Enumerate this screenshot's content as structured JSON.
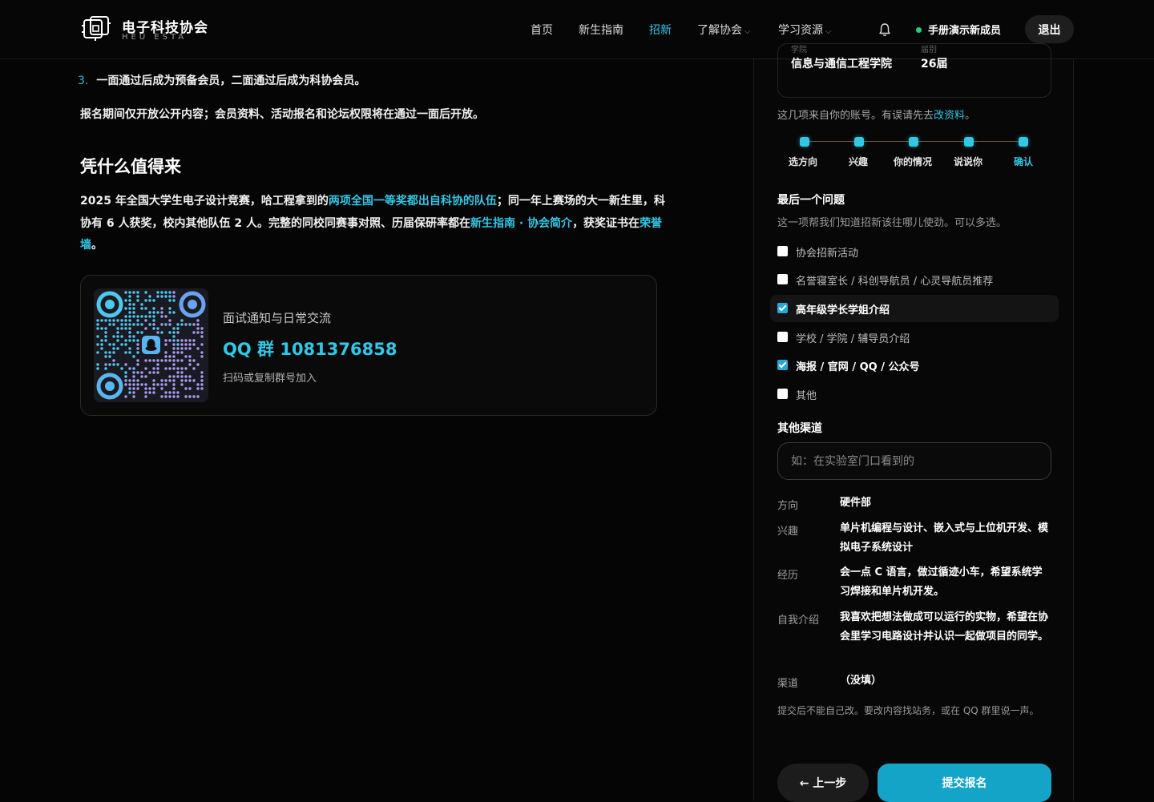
{
  "brand": {
    "title": "电子科技协会",
    "subtitle": "HEU ESTA"
  },
  "nav": [
    {
      "label": "首页"
    },
    {
      "label": "新生指南"
    },
    {
      "label": "招新",
      "active": true
    },
    {
      "label": "了解协会",
      "dropdown": true
    },
    {
      "label": "学习资源",
      "dropdown": true
    }
  ],
  "header": {
    "user_label": "手册演示新成员",
    "logout_label": "退出",
    "bell_icon": "bell-icon"
  },
  "article": {
    "step3_num": "3.",
    "step3_text": "一面通过后成为预备会员，二面通过后成为科协会员。",
    "notice": "报名期间仅开放公开内容；会员资料、活动报名和论坛权限将在通过一面后开放。",
    "section_title": "凭什么值得来",
    "para_1": "2025 年全国大学生电子设计竞赛，哈工程拿到的",
    "para_hl": "两项全国一等奖都出自科协的队伍",
    "para_2": "；同一年上赛场的大一新生里，科协有 6 人获奖，校内其他队伍 2 人。完整的同校同赛事对照、历届保研率都在",
    "link_guide": "新生指南",
    "link_sep": " · ",
    "link_about": "协会简介",
    "para_3": "，获奖证书在",
    "link_honor": "荣誉墙",
    "para_4": "。"
  },
  "qq_card": {
    "title": "面试通知与日常交流",
    "number": "QQ 群 1081376858",
    "hint": "扫码或复制群号加入",
    "colors": {
      "qr_cyan": "#4fc8ee",
      "qr_violet": "#a79cf0"
    }
  },
  "account": {
    "college_label": "学院",
    "college": "信息与通信工程学院",
    "grade_label": "届别",
    "grade": "26届",
    "note_prefix": "这几项来自你的账号。有误请先去",
    "note_link": "改资料",
    "note_suffix": "。"
  },
  "steps": [
    {
      "label": "选方向"
    },
    {
      "label": "兴趣"
    },
    {
      "label": "你的情况"
    },
    {
      "label": "说说你"
    },
    {
      "label": "确认",
      "active": true
    }
  ],
  "question": {
    "title": "最后一个问题",
    "subtitle": "这一项帮我们知道招新该往哪儿使劲。可以多选。",
    "options": [
      {
        "label": "协会招新活动",
        "checked": false
      },
      {
        "label": "名誉寝室长 / 科创导航员 / 心灵导航员推荐",
        "checked": false
      },
      {
        "label": "高年级学长学姐介绍",
        "checked": true
      },
      {
        "label": "学校 / 学院 / 辅导员介绍",
        "checked": false
      },
      {
        "label": "海报 / 官网 / QQ / 公众号",
        "checked": true
      },
      {
        "label": "其他",
        "checked": false
      }
    ]
  },
  "other_channel": {
    "label": "其他渠道",
    "placeholder": "如：在实验室门口看到的",
    "value": ""
  },
  "summary": [
    {
      "key": "方向",
      "value": "硬件部"
    },
    {
      "key": "兴趣",
      "value": "单片机编程与设计、嵌入式与上位机开发、模拟电子系统设计"
    },
    {
      "key": "经历",
      "value": "会一点 C 语言，做过循迹小车，希望系统学习焊接和单片机开发。"
    },
    {
      "key": "自我介绍",
      "value": "我喜欢把想法做成可以运行的实物，希望在协会里学习电路设计并认识一起做项目的同学。"
    },
    {
      "key": "渠道",
      "value": "（没填）"
    }
  ],
  "footnote": "提交后不能自己改。要改内容找站务，或在 QQ 群里说一声。",
  "buttons": {
    "prev": "← 上一步",
    "submit": "提交报名"
  },
  "colors": {
    "accent": "#33c7e6",
    "online": "#22d17a",
    "submit_bg": "#14a4c8"
  }
}
